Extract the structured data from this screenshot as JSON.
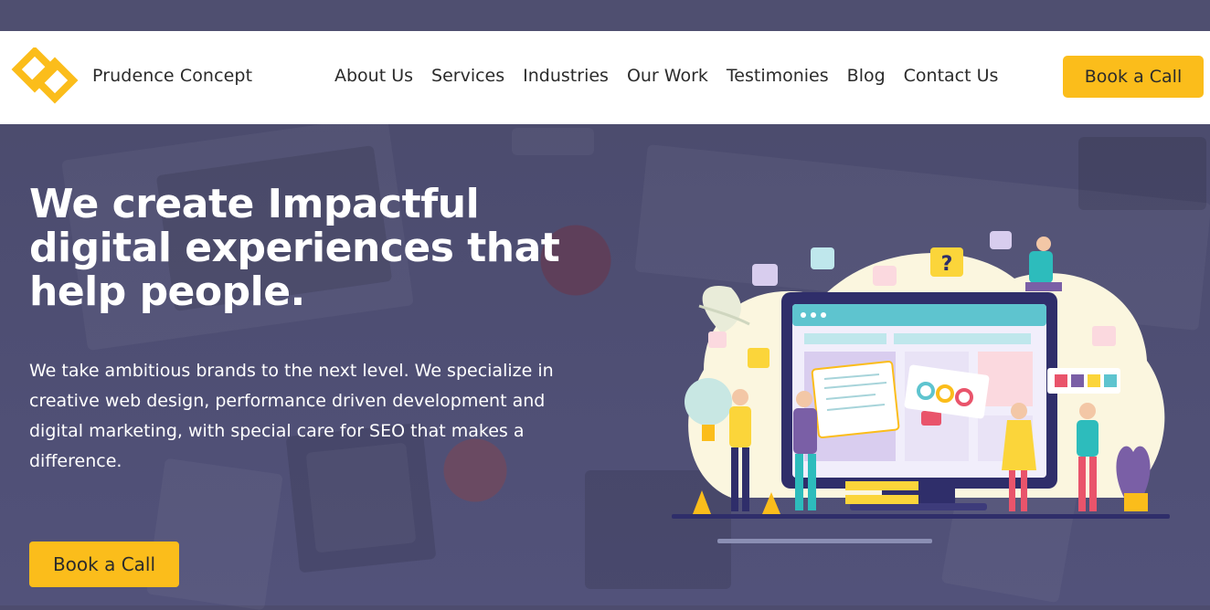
{
  "brand": {
    "name": "Prudence Concept"
  },
  "nav": {
    "items": [
      {
        "label": "About Us"
      },
      {
        "label": "Services"
      },
      {
        "label": "Industries"
      },
      {
        "label": "Our Work"
      },
      {
        "label": "Testimonies"
      },
      {
        "label": "Blog"
      },
      {
        "label": "Contact Us"
      }
    ]
  },
  "header": {
    "cta_label": "Book a Call"
  },
  "hero": {
    "headline": "We create Impactful digital experiences that help people.",
    "description": "We take ambitious brands to the next level. We specialize in creative web design, performance driven development and digital marketing, with special care for SEO that makes a difference.",
    "cta_label": "Book a Call",
    "illustration_icon": "web-design-team-illustration"
  },
  "colors": {
    "accent": "#fbbd1b",
    "hero_background": "#4d4c6e",
    "header_background": "#ffffff",
    "text_dark": "#2b2b2b"
  }
}
